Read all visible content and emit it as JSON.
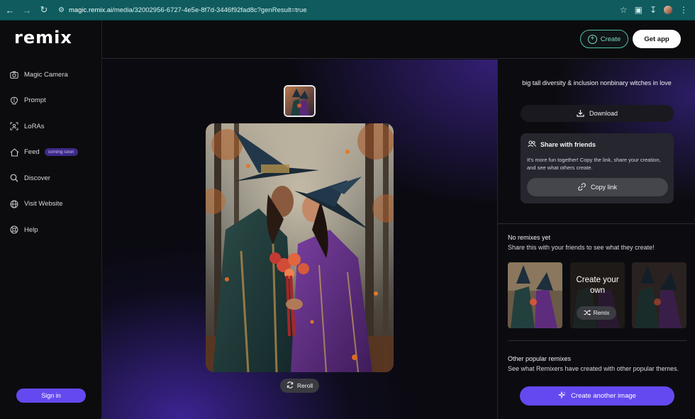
{
  "browser": {
    "url_host": "magic.remix.ai",
    "url_path": "/media/32002956-6727-4e5e-8f7d-3446f92fad8c?genResult=true"
  },
  "sidebar": {
    "logo": "remix",
    "items": [
      {
        "label": "Magic Camera",
        "icon": "camera-icon"
      },
      {
        "label": "Prompt",
        "icon": "brain-icon"
      },
      {
        "label": "LoRAs",
        "icon": "scan-face-icon"
      },
      {
        "label": "Feed",
        "icon": "home-icon",
        "badge": "coming soon"
      },
      {
        "label": "Discover",
        "icon": "search-icon"
      },
      {
        "label": "Visit Website",
        "icon": "globe-icon"
      },
      {
        "label": "Help",
        "icon": "lifebuoy-icon"
      }
    ],
    "signin_label": "Sign in"
  },
  "header": {
    "create_label": "Create",
    "getapp_label": "Get app"
  },
  "stage": {
    "reroll_label": "Reroll"
  },
  "panel": {
    "prompt": "big tall diversity & inclusion nonbinary witches in love",
    "download_label": "Download",
    "share_title": "Share with friends",
    "share_desc": "It's more fun together! Copy the link, share your creation, and see what others create.",
    "copy_label": "Copy link",
    "remix_title": "No remixes yet",
    "remix_sub": "Share this with your friends to see what they create!",
    "create_own": "Create your own",
    "remix_label": "Remix",
    "other_title": "Other popular remixes",
    "other_sub": "See what Remixers have created with other popular themes.",
    "create_another_label": "Create another image"
  },
  "colors": {
    "accent": "#6549f0",
    "create_outline": "#4bc0a8",
    "browser_bar": "#0f5b5e"
  }
}
